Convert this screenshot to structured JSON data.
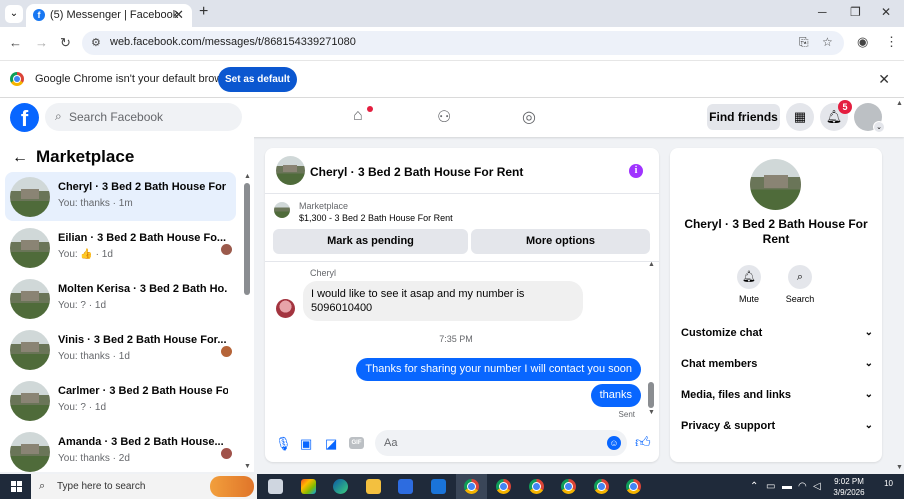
{
  "browser": {
    "tab_title": "(5) Messenger | Facebook",
    "url": "web.facebook.com/messages/t/868154339271080",
    "infobar_message": "Google Chrome isn't your default browser",
    "set_default_label": "Set as default"
  },
  "fb_header": {
    "search_placeholder": "Search Facebook",
    "find_friends_label": "Find friends",
    "notification_count": "5"
  },
  "left_panel": {
    "title": "Marketplace",
    "chats": [
      {
        "name": "Cheryl · 3 Bed 2 Bath House For ...",
        "preview": "You: thanks · 1m"
      },
      {
        "name": "Eilian · 3 Bed 2 Bath House Fo...",
        "preview": "You: 👍 · 1d"
      },
      {
        "name": "Molten Kerisa · 3 Bed 2 Bath Ho...",
        "preview": "You: ? · 1d"
      },
      {
        "name": "Vinis · 3 Bed 2 Bath House For...",
        "preview": "You: thanks · 1d"
      },
      {
        "name": "Carlmer · 3 Bed 2 Bath House Fo...",
        "preview": "You: ? · 1d"
      },
      {
        "name": "Amanda · 3 Bed 2 Bath House...",
        "preview": "You: thanks · 2d"
      }
    ]
  },
  "conversation": {
    "title": "Cheryl · 3 Bed 2 Bath House For Rent",
    "listing_label": "Marketplace",
    "listing_price": "$1,300 - 3 Bed 2 Bath House For Rent",
    "mark_pending_label": "Mark as pending",
    "more_options_label": "More options",
    "sender_name": "Cheryl",
    "incoming_message": "I would like to see it asap and my number is 5096010400",
    "timestamp": "7:35 PM",
    "outgoing_1": "Thanks for sharing your number I will contact you soon",
    "outgoing_2": "thanks",
    "status": "Sent",
    "composer_placeholder": "Aa"
  },
  "info_panel": {
    "name": "Cheryl · 3 Bed 2 Bath House For Rent",
    "mute_label": "Mute",
    "search_label": "Search",
    "sections": [
      "Customize chat",
      "Chat members",
      "Media, files and links",
      "Privacy & support"
    ]
  },
  "taskbar": {
    "search_placeholder": "Type here to search",
    "time": "9:02 PM",
    "date": "3/9/2026",
    "notification_count": "10"
  },
  "colors": {
    "fb_blue": "#0866ff",
    "active_chat_bg": "#e7f0fd",
    "chrome_button": "#0b57d0",
    "badge_red": "#e41e3f"
  }
}
